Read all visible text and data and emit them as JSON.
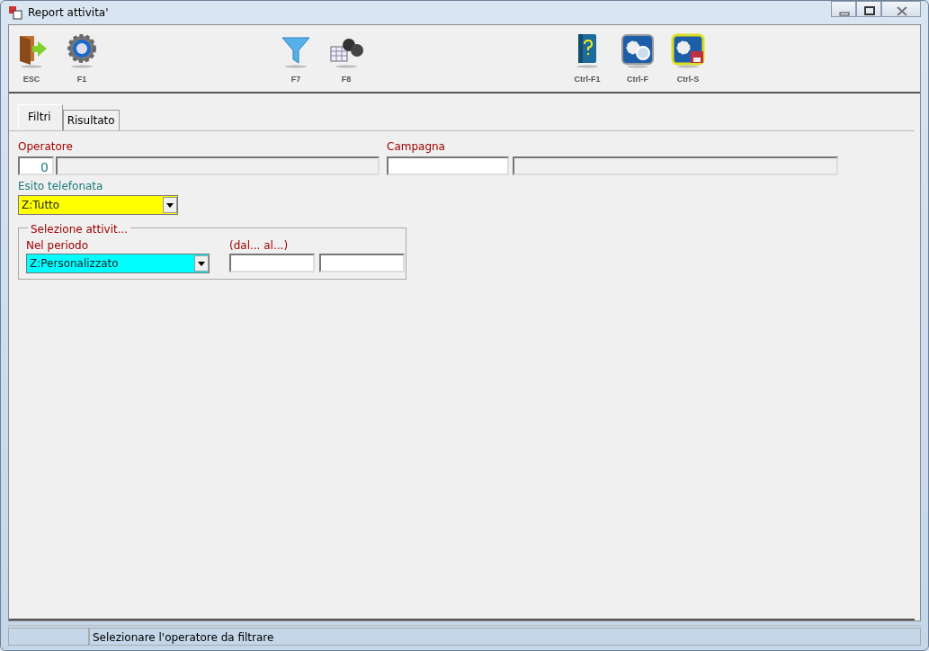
{
  "window": {
    "title": "Report attivita'"
  },
  "toolbar_groups": [
    [
      {
        "label": "ESC",
        "kind": "exit"
      },
      {
        "label": "F1",
        "kind": "gear"
      }
    ],
    [
      {
        "label": "F7",
        "kind": "funnel"
      },
      {
        "label": "F8",
        "kind": "binoculars"
      }
    ],
    [
      {
        "label": "Ctrl-F1",
        "kind": "book"
      },
      {
        "label": "Ctrl-F",
        "kind": "search"
      },
      {
        "label": "Ctrl-S",
        "kind": "save"
      }
    ]
  ],
  "tabs": [
    {
      "label": "Filtri",
      "selected": true
    },
    {
      "label": "Risultato",
      "selected": false
    }
  ],
  "operatore": {
    "label": "Operatore",
    "code": "0"
  },
  "campagna": {
    "label": "Campagna"
  },
  "esito": {
    "label": "Esito telefonata",
    "value": "Z:Tutto"
  },
  "selezione": {
    "legend": "Selezione attivit...",
    "period_label": "Nel periodo",
    "period_value": "Z:Personalizzato",
    "range_label": "(dal... al...)"
  },
  "status_bar": {
    "message": "Selezionare l'operatore da filtrare"
  }
}
